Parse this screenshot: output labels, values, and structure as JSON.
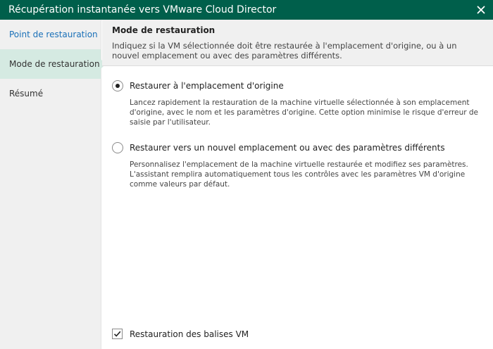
{
  "window": {
    "title": "Récupération instantanée vers VMware Cloud Director",
    "close_icon": "close-icon"
  },
  "sidebar": {
    "items": [
      {
        "label": "Point de restauration",
        "state": "link"
      },
      {
        "label": "Mode de restauration",
        "state": "active"
      },
      {
        "label": "Résumé",
        "state": "normal"
      }
    ]
  },
  "header": {
    "title": "Mode de restauration",
    "description": "Indiquez si la VM sélectionnée doit être restaurée à l'emplacement d'origine, ou à un nouvel emplacement ou avec des paramètres différents."
  },
  "options": [
    {
      "label": "Restaurer à l'emplacement d'origine",
      "description": "Lancez rapidement la restauration de la machine virtuelle sélectionnée à son emplacement d'origine, avec le nom et les paramètres d'origine. Cette option minimise le risque d'erreur de saisie par l'utilisateur.",
      "selected": true
    },
    {
      "label": "Restaurer vers un nouvel emplacement ou avec des paramètres différents",
      "description": "Personnalisez l'emplacement de la machine virtuelle restaurée et modifiez ses paramètres. L'assistant remplira automatiquement tous les contrôles avec les paramètres VM d'origine comme valeurs par défaut.",
      "selected": false
    }
  ],
  "restore_tags": {
    "label": "Restauration des balises VM",
    "checked": true
  },
  "colors": {
    "titlebar": "#005f4b",
    "active_nav": "#d5eae2",
    "link": "#1a70b8"
  }
}
